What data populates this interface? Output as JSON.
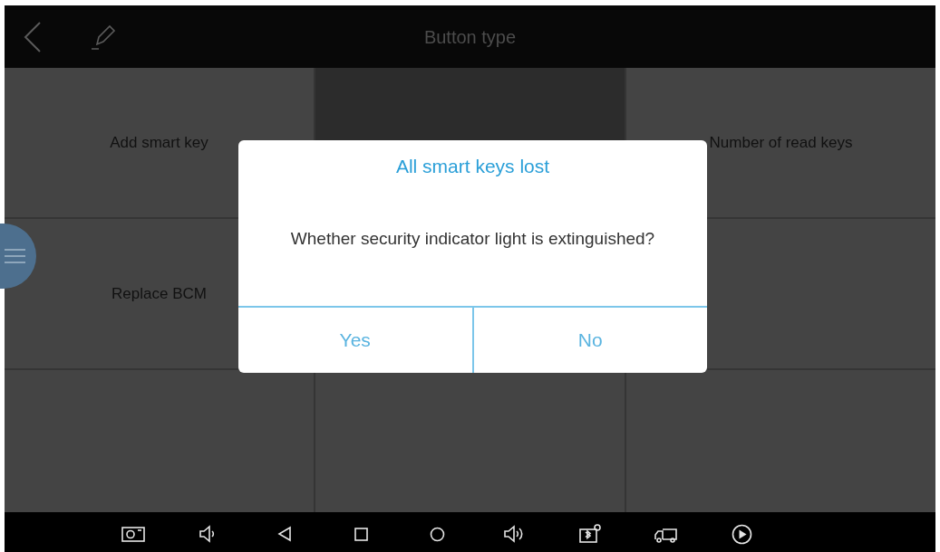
{
  "top_bar": {
    "title": "Button type"
  },
  "tiles": [
    {
      "label": "Add smart key",
      "selected": false
    },
    {
      "selected": true
    },
    {
      "label": "Number of read keys",
      "selected": false
    },
    {
      "label": "Replace BCM",
      "selected": false
    },
    {
      "selected": false
    },
    {
      "selected": false
    },
    {
      "selected": false
    },
    {
      "selected": false
    }
  ],
  "dialog": {
    "title": "All smart keys lost",
    "message": "Whether security indicator light is extinguished?",
    "buttons": [
      "Yes",
      "No"
    ]
  }
}
